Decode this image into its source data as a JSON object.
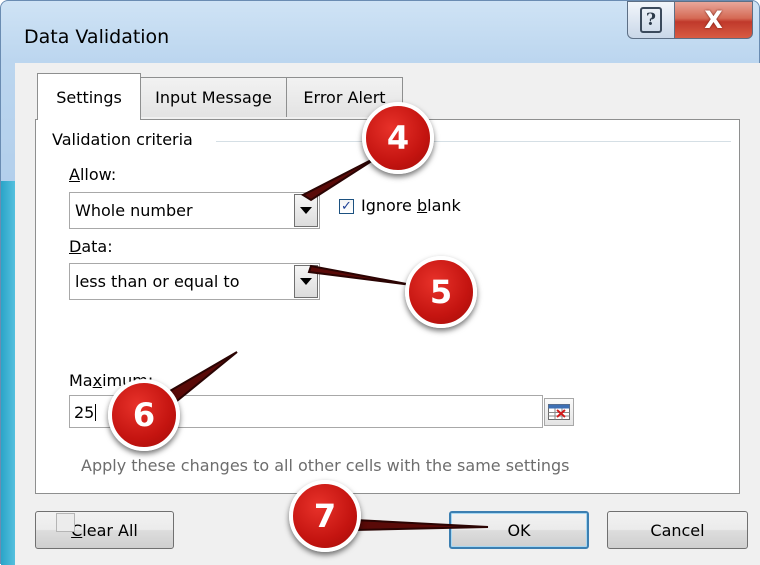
{
  "window": {
    "title": "Data Validation",
    "help_glyph": "?",
    "close_glyph": "X"
  },
  "tabs": [
    {
      "label": "Settings",
      "active": true
    },
    {
      "label": "Input Message",
      "active": false
    },
    {
      "label": "Error Alert",
      "active": false
    }
  ],
  "settings": {
    "group_label": "Validation criteria",
    "allow": {
      "label_prefix": "",
      "label_accel": "A",
      "label_rest": "llow:",
      "value": "Whole number"
    },
    "ignore_blank": {
      "label_pre": "Ignore ",
      "label_accel": "b",
      "label_rest": "lank",
      "checked": true
    },
    "data": {
      "label_accel": "D",
      "label_rest": "ata:",
      "value": "less than or equal to"
    },
    "maximum": {
      "label_pre": "Ma",
      "label_accel": "x",
      "label_rest": "imum:",
      "value": "25"
    },
    "apply_all": {
      "label": "Apply these changes to all other cells with the same settings",
      "checked": false
    }
  },
  "buttons": {
    "clear_all_accel": "C",
    "clear_all_rest": "lear All",
    "ok": "OK",
    "cancel": "Cancel"
  },
  "annotations": [
    "4",
    "5",
    "6",
    "7"
  ],
  "icons": {
    "help": "help-icon",
    "close": "close-icon",
    "dropdown": "chevron-down-icon",
    "range_picker": "range-select-icon"
  },
  "colors": {
    "badge": "#c41410",
    "close_button": "#c0392b",
    "accent_border": "#3c7fb1"
  }
}
